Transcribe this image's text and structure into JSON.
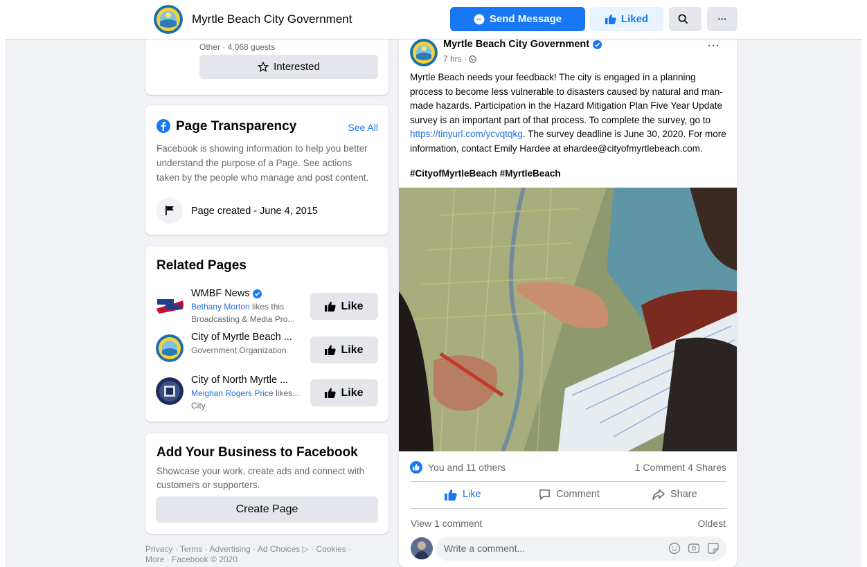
{
  "header": {
    "page_name": "Myrtle Beach City Government",
    "send_message": "Send Message",
    "liked": "Liked",
    "search_icon": "search-icon",
    "more_label": "···"
  },
  "event": {
    "subtitle": "Other · 4,068 guests",
    "interested": "Interested"
  },
  "transparency": {
    "title": "Page Transparency",
    "see_all": "See All",
    "description": "Facebook is showing information to help you better understand the purpose of a Page. See actions taken by the people who manage and post content.",
    "created": "Page created - June 4, 2015"
  },
  "related": {
    "title": "Related Pages",
    "like_label": "Like",
    "items": [
      {
        "name": "WMBF News",
        "friend": "Bethany Morton",
        "friend_suffix": " likes this",
        "category": "Broadcasting & Media Pro...",
        "verified": true
      },
      {
        "name": "City of Myrtle Beach ...",
        "friend": "",
        "friend_suffix": "",
        "category": "Government Organization",
        "verified": false
      },
      {
        "name": "City of North Myrtle ...",
        "friend": "Meighan Rogers Price",
        "friend_suffix": " likes...",
        "category": "City",
        "verified": false
      }
    ]
  },
  "business": {
    "title": "Add Your Business to Facebook",
    "description": "Showcase your work, create ads and connect with customers or supporters.",
    "button": "Create Page"
  },
  "footer": {
    "line1": "Privacy · Terms · Advertising · Ad Choices ▷ · Cookies ·",
    "line2": "More · Facebook © 2020"
  },
  "post": {
    "author": "Myrtle Beach City Government",
    "time": "7 hrs ·",
    "more": "···",
    "text_before": "Myrtle Beach needs your feedback!  The city is engaged in a planning process to become less vulnerable to disasters caused by natural and man-made hazards.  Participation in the Hazard Mitigation Plan Five Year Update survey is an important part of that process.  To complete the survey, go to ",
    "link": "https://tinyurl.com/ycvqtqkg",
    "text_after": ".  The survey deadline is June 30, 2020.  For more information, contact Emily Hardee at ehardee@cityofmyrtlebeach.com.",
    "hashtags": "#CityofMyrtleBeach #MyrtleBeach",
    "reactions": "You and 11 others",
    "counts": "1 Comment  4 Shares",
    "like": "Like",
    "comment": "Comment",
    "share": "Share",
    "view_comments": "View 1 comment",
    "sort": "Oldest",
    "comment_placeholder": "Write a comment..."
  },
  "colors": {
    "accent": "#1877f2",
    "background": "#f0f2f5",
    "button_gray": "#e4e6eb"
  }
}
